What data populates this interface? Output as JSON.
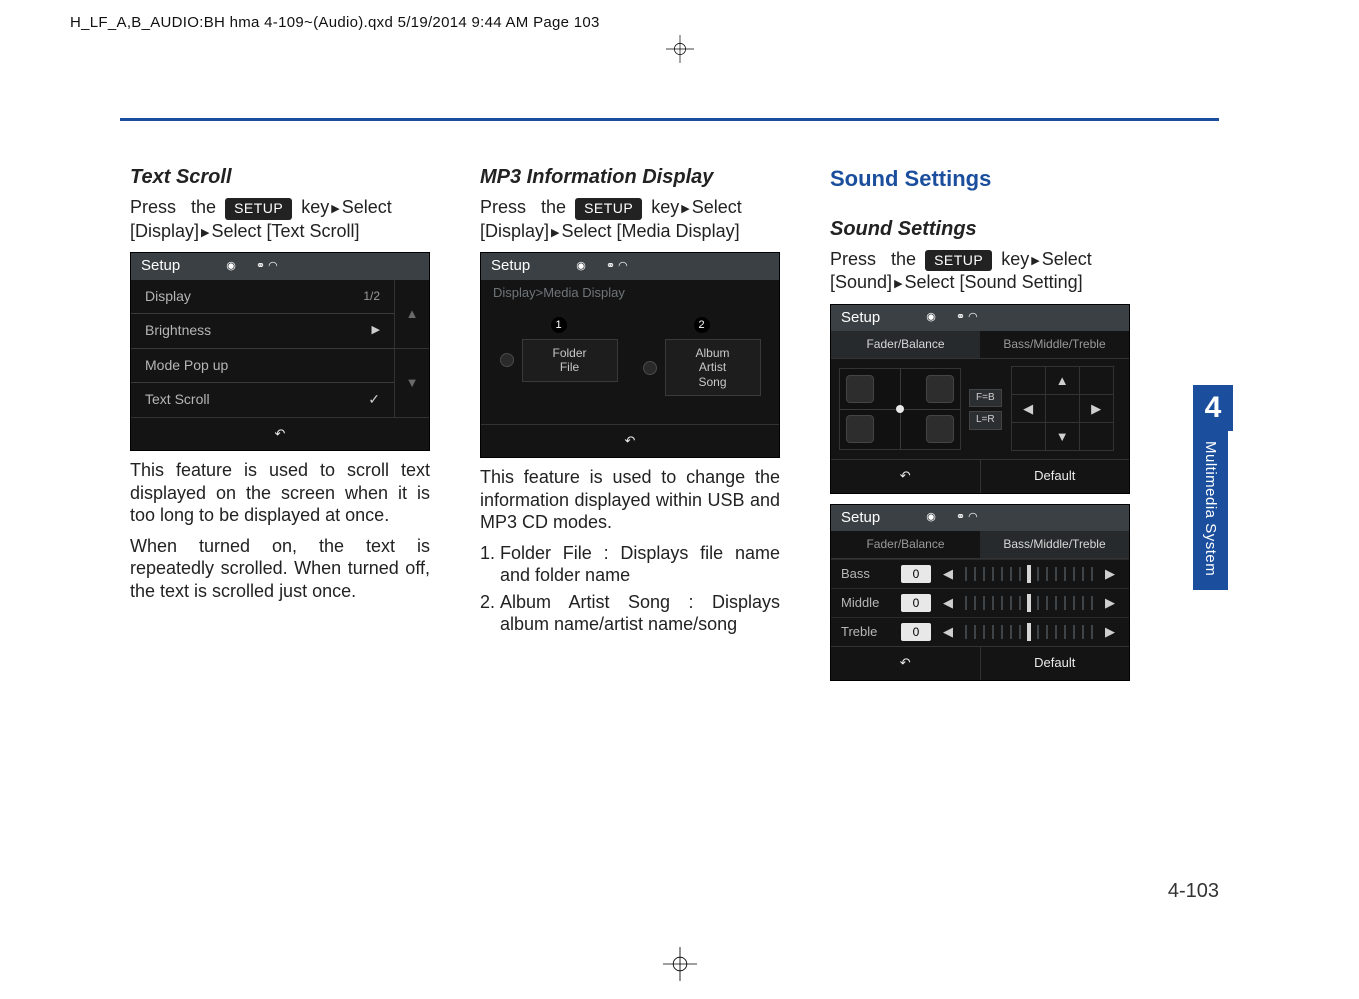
{
  "header_line": "H_LF_A,B_AUDIO:BH hma 4-109~(Audio).qxd  5/19/2014  9:44 AM  Page 103",
  "common": {
    "press": "Press",
    "the": "the",
    "setup_key": "SETUP",
    "key": "key",
    "select": "Select"
  },
  "screens": {
    "setup_title": "Setup",
    "back_icon": "↶",
    "default_label": "Default"
  },
  "col1": {
    "heading": "Text Scroll",
    "path1": "[Display]",
    "path2": "Select [Text Scroll]",
    "screen": {
      "page_indicator": "1/2",
      "rows": [
        "Display",
        "Brightness",
        "Mode Pop up",
        "Text Scroll"
      ],
      "right_marks": [
        "",
        "▶",
        "",
        "✓"
      ]
    },
    "para1": "This feature is used to scroll text displayed on the screen when it is too long to be displayed at once.",
    "para2": "When turned on, the text is repeatedly scrolled. When turned off, the text is scrolled just once."
  },
  "col2": {
    "heading": "MP3 Information Display",
    "path1": "[Display]",
    "path2": "Select [Media Display]",
    "screen": {
      "sub": "Display>Media Display",
      "opt1": {
        "num": "1",
        "line1": "Folder",
        "line2": "File"
      },
      "opt2": {
        "num": "2",
        "line1": "Album",
        "line2": "Artist",
        "line3": "Song"
      }
    },
    "para1": "This feature is used to change the information displayed within USB and MP3 CD modes.",
    "list": [
      "Folder File : Displays file name and folder name",
      "Album Artist Song : Displays album name/artist name/song"
    ]
  },
  "col3": {
    "heading_blue": "Sound Settings",
    "heading": "Sound Settings",
    "path1": "[Sound]",
    "path2": "Select [Sound Setting]",
    "screen1": {
      "tab1": "Fader/Balance",
      "tab2": "Bass/Middle/Treble",
      "fb_label": "F=B",
      "lr_label": "L=R"
    },
    "screen2": {
      "tab1": "Fader/Balance",
      "tab2": "Bass/Middle/Treble",
      "rows": [
        {
          "name": "Bass",
          "val": "0"
        },
        {
          "name": "Middle",
          "val": "0"
        },
        {
          "name": "Treble",
          "val": "0"
        }
      ]
    }
  },
  "side": {
    "num": "4",
    "label": "Multimedia System"
  },
  "page_number": "4-103"
}
